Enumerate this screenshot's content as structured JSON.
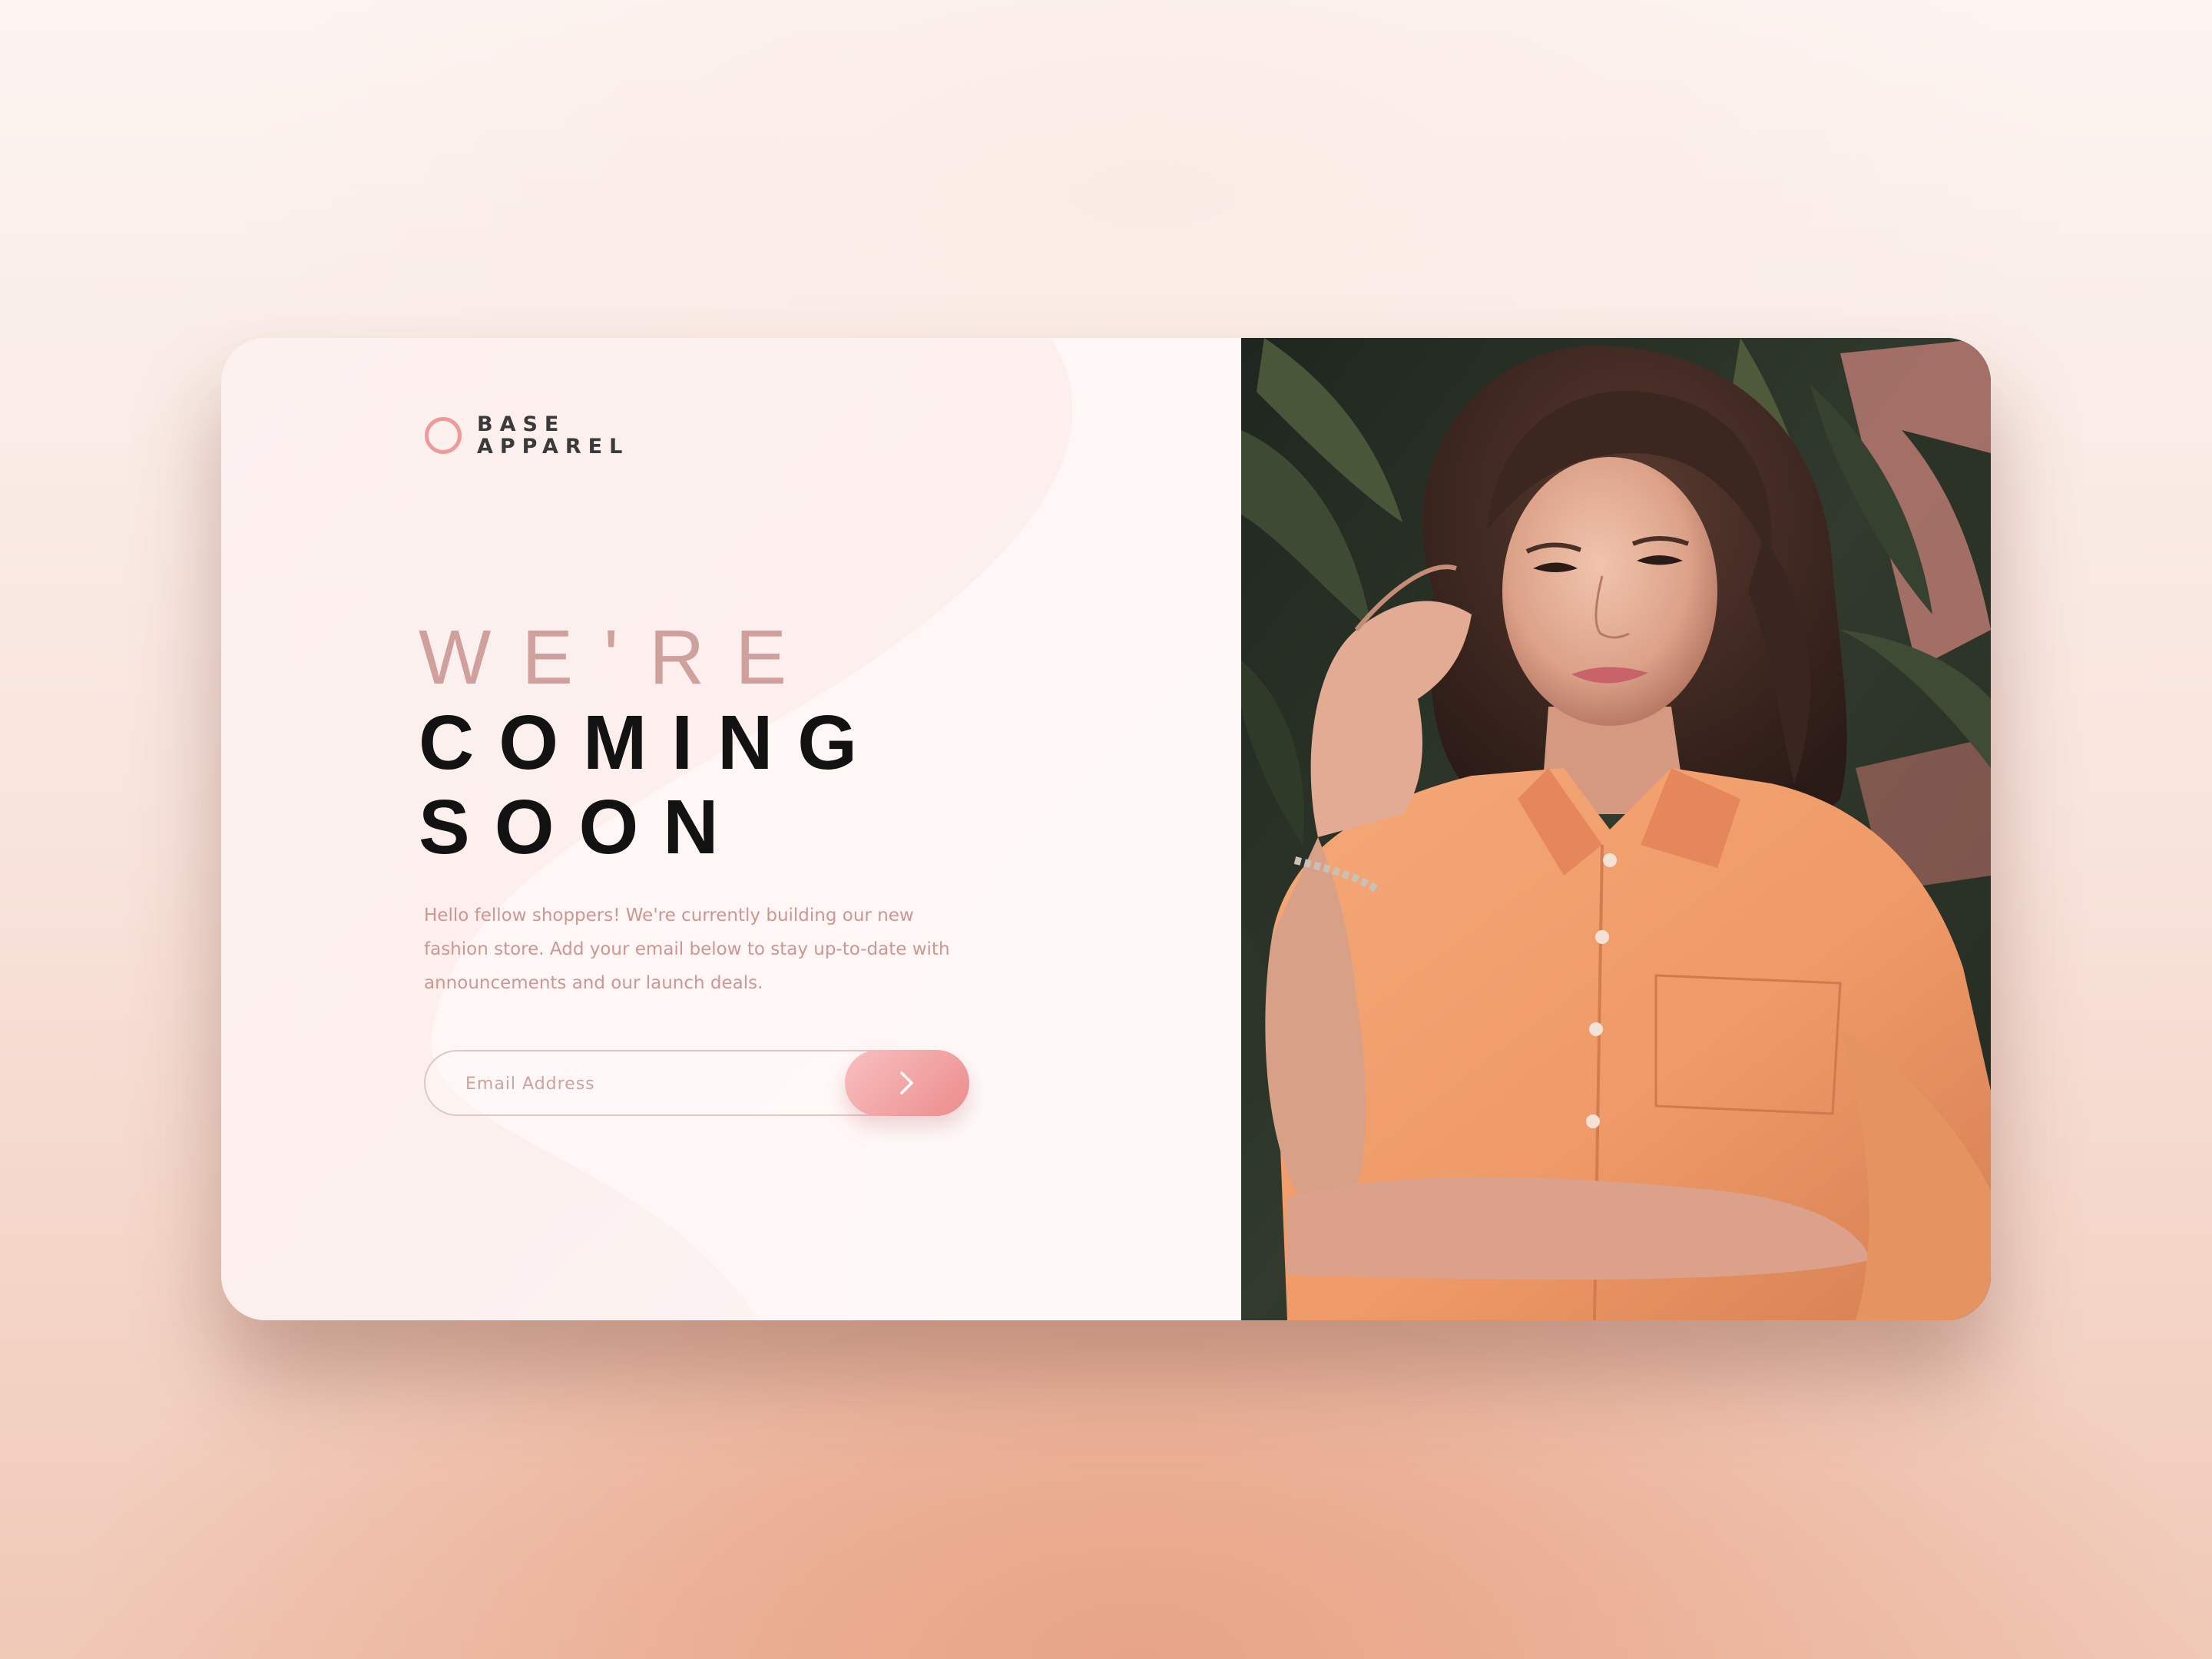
{
  "brand": {
    "line1": "BASE",
    "line2": "APPAREL",
    "accent_color": "#ef9a99"
  },
  "hero": {
    "headline_light": "WE'RE",
    "headline_bold_1": "COMING",
    "headline_bold_2": "SOON",
    "description": "Hello fellow shoppers! We're currently building our new fashion store. Add your email below to stay up-to-date with announcements and our launch deals."
  },
  "signup": {
    "email_placeholder": "Email Address",
    "submit_icon": "chevron-right-icon"
  },
  "photo": {
    "subject": "woman-in-orange-shirt-photo"
  }
}
